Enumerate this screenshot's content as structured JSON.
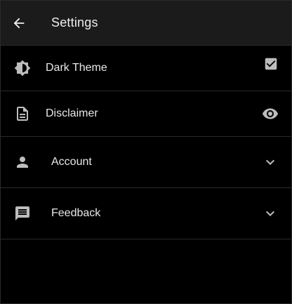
{
  "header": {
    "title": "Settings",
    "back_icon": "arrow-left-icon"
  },
  "settings": {
    "items": [
      {
        "label": "Dark Theme",
        "icon": "brightness-icon",
        "control": "checkbox",
        "checked": true
      },
      {
        "label": "Disclaimer",
        "icon": "document-icon",
        "control": "eye-icon"
      },
      {
        "label": "Account",
        "icon": "person-icon",
        "control": "chevron-down-icon"
      },
      {
        "label": "Feedback",
        "icon": "feedback-icon",
        "control": "chevron-down-icon"
      }
    ]
  },
  "colors": {
    "background": "#000000",
    "appbar": "#1b1b1b",
    "divider": "#2a2a2a",
    "icon": "#bdbdbd",
    "text": "#e8e8e8"
  }
}
